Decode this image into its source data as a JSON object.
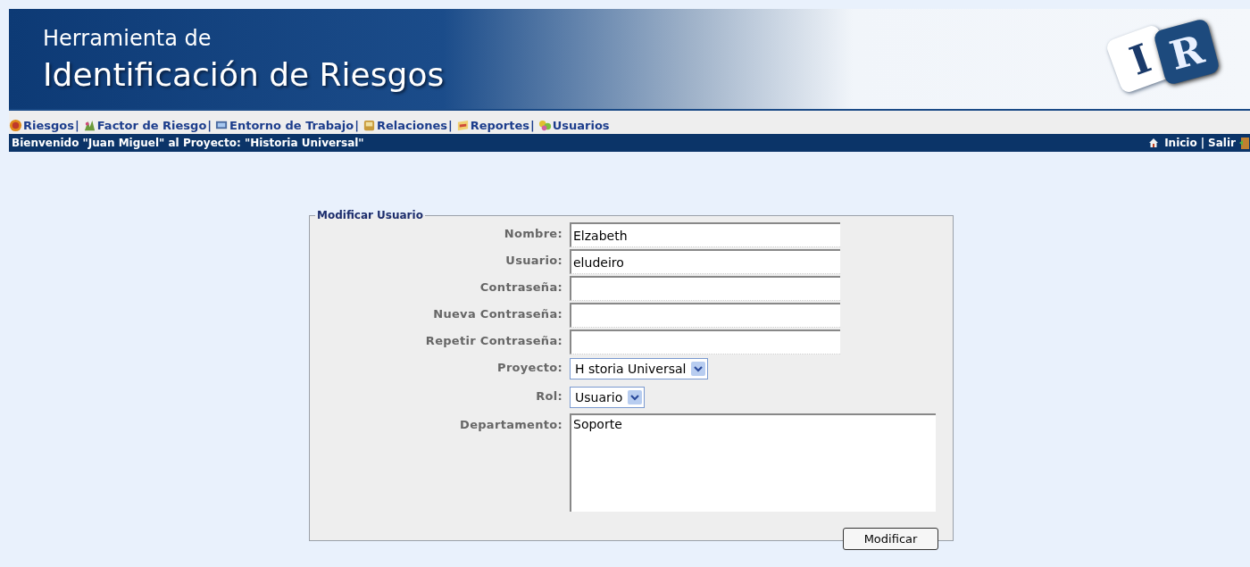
{
  "header": {
    "title_small": "Herramienta de",
    "title_large": "Identificación de Riesgos",
    "logo_letters": [
      "I",
      "R"
    ]
  },
  "nav": {
    "items": [
      {
        "label": "Riesgos"
      },
      {
        "label": "Factor de Riesgo"
      },
      {
        "label": "Entorno de Trabajo"
      },
      {
        "label": "Relaciones"
      },
      {
        "label": "Reportes"
      },
      {
        "label": "Usuarios"
      }
    ],
    "separator": "|"
  },
  "welcome_bar": {
    "message": "Bienvenido \"Juan Miguel\" al Proyecto: \"Historia Universal\"",
    "links": [
      "Inicio",
      "Salir"
    ],
    "separator": "|"
  },
  "form": {
    "legend": "Modificar Usuario",
    "fields": [
      {
        "label": "Nombre:",
        "kind": "text",
        "value": "Elzabeth"
      },
      {
        "label": "Usuario:",
        "kind": "text",
        "value": "eludeiro"
      },
      {
        "label": "Contraseña:",
        "kind": "password"
      },
      {
        "label": "Nueva Contraseña:",
        "kind": "password"
      },
      {
        "label": "Repetir Contraseña:",
        "kind": "password"
      },
      {
        "label": "Proyecto:",
        "kind": "select",
        "value": "H storia Universal"
      },
      {
        "label": "Rol:",
        "kind": "select",
        "value": "Usuario"
      },
      {
        "label": "Departamento:",
        "kind": "textarea",
        "value": "Soporte"
      }
    ],
    "button": "Modificar"
  }
}
